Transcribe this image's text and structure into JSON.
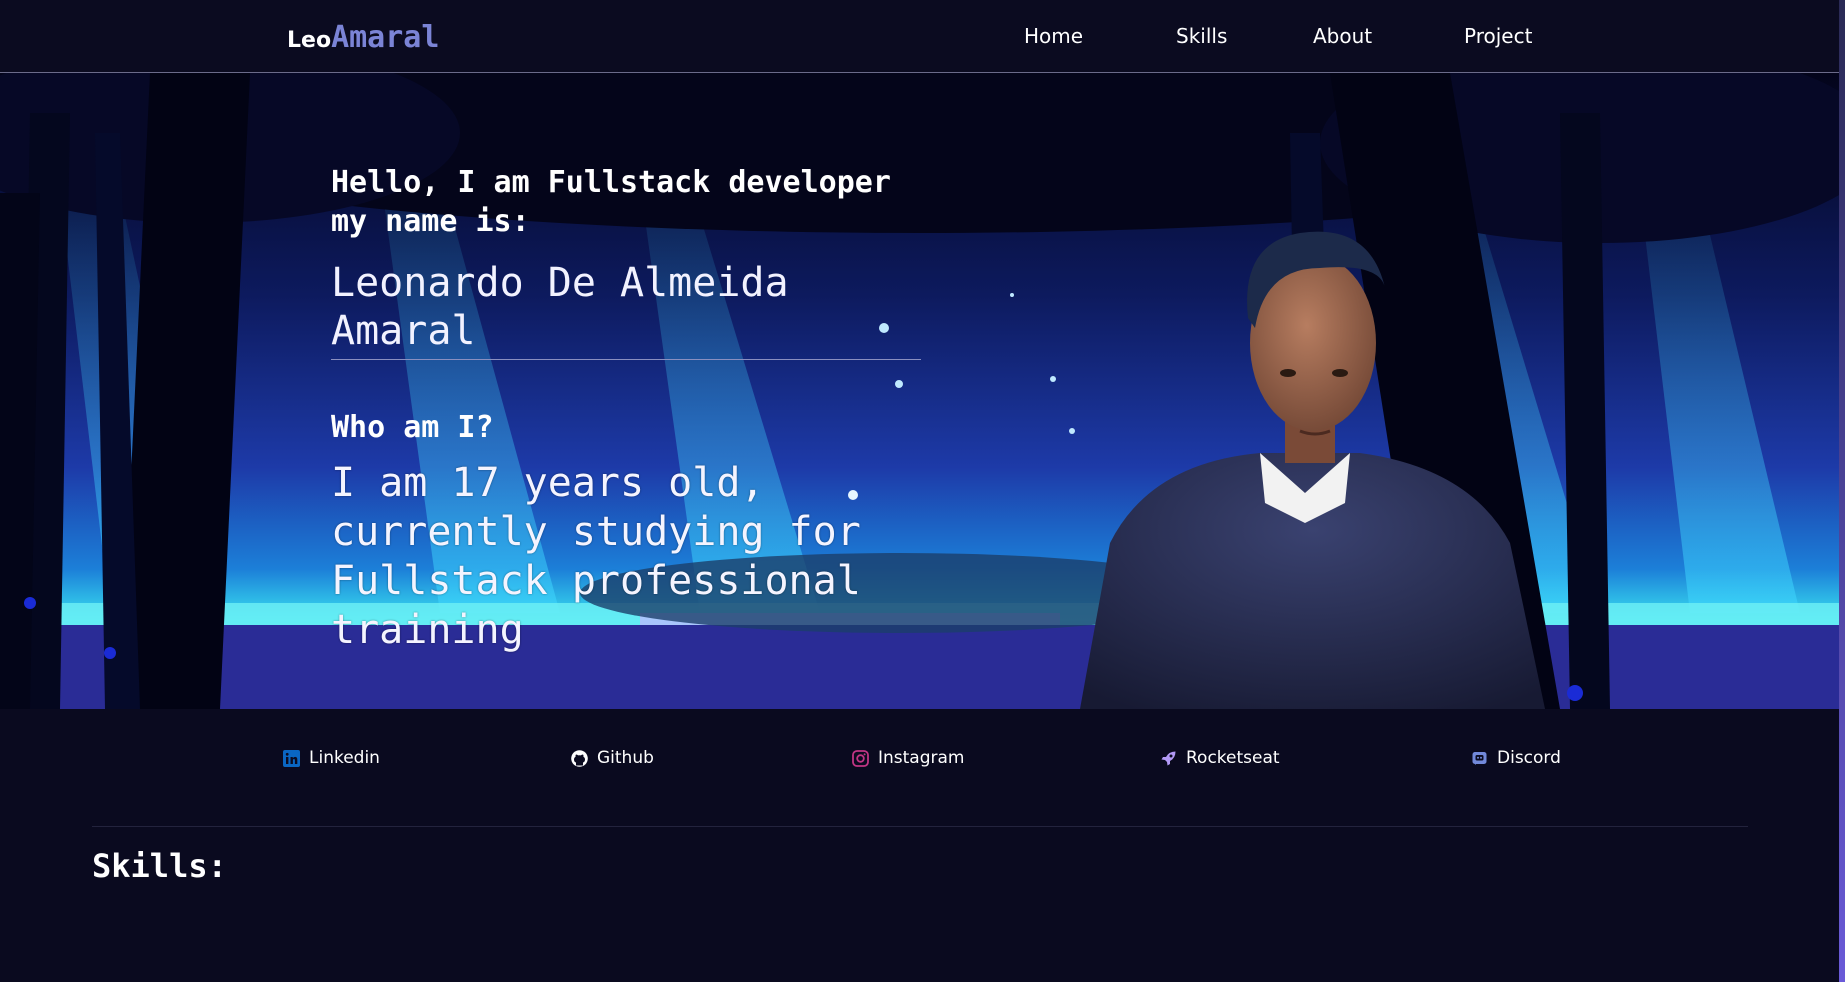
{
  "header": {
    "logo_first": "Leo",
    "logo_second": "Amaral",
    "nav": [
      "Home",
      "Skills",
      "About",
      "Project"
    ]
  },
  "hero": {
    "greeting": "Hello, I am Fullstack developer my name is:",
    "name": "Leonardo De Almeida Amaral",
    "who_title": "Who am I?",
    "bio": "I am 17 years old, currently studying for Fullstack professional training"
  },
  "socials": [
    {
      "label": "Linkedin",
      "icon": "linkedin-icon",
      "color": "#0a66c2"
    },
    {
      "label": "Github",
      "icon": "github-icon",
      "color": "#ffffff"
    },
    {
      "label": "Instagram",
      "icon": "instagram-icon",
      "color": "#c13584"
    },
    {
      "label": "Rocketseat",
      "icon": "rocket-icon",
      "color": "#b39af7"
    },
    {
      "label": "Discord",
      "icon": "discord-icon",
      "color": "#7289da"
    }
  ],
  "skills": {
    "title": "Skills:"
  },
  "colors": {
    "background": "#0a0a1f",
    "accent": "#7b84d6"
  }
}
